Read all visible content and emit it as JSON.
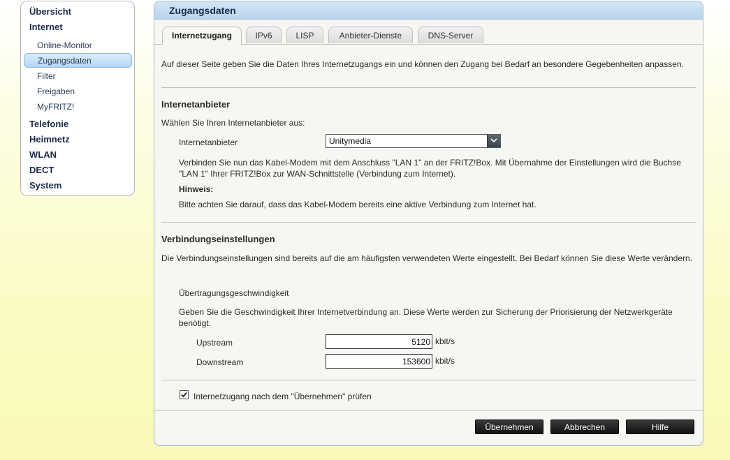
{
  "sidebar": {
    "overview": "Übersicht",
    "internet": "Internet",
    "internet_items": [
      "Online-Monitor",
      "Zugangsdaten",
      "Filter",
      "Freigaben",
      "MyFRITZ!"
    ],
    "telephony": "Telefonie",
    "home_network": "Heimnetz",
    "wlan": "WLAN",
    "dect": "DECT",
    "system": "System"
  },
  "panel": {
    "title": "Zugangsdaten",
    "tabs": [
      "Internetzugang",
      "IPv6",
      "LISP",
      "Anbieter-Dienste",
      "DNS-Server"
    ],
    "intro": "Auf dieser Seite geben Sie die Daten Ihres Internetzugangs ein und können den Zugang bei Bedarf an besondere Gegebenheiten anpassen."
  },
  "provider": {
    "heading": "Internetanbieter",
    "prompt": "Wählen Sie Ihren Internetanbieter aus:",
    "label": "Internetanbieter",
    "selected": "Unitymedia",
    "info": "Verbinden Sie nun das Kabel-Modem mit dem Anschluss \"LAN 1\" an der FRITZ!Box. Mit Übernahme der Einstellungen wird die Buchse \"LAN 1\" Ihrer FRITZ!Box zur WAN-Schnittstelle (Verbindung zum Internet).",
    "note_label": "Hinweis:",
    "note": "Bitte achten Sie darauf, dass das Kabel-Modem bereits eine aktive Verbindung zum Internet hat."
  },
  "connection": {
    "heading": "Verbindungseinstellungen",
    "desc": "Die Verbindungseinstellungen sind bereits auf die am häufigsten verwendeten Werte eingestellt. Bei Bedarf können Sie diese Werte verändern.",
    "speed_heading": "Übertragungsgeschwindigkeit",
    "speed_desc": "Geben Sie die Geschwindigkeit Ihrer Internetverbindung an. Diese Werte werden zur Sicherung der Priorisierung der Netzwerkgeräte benötigt.",
    "upstream_label": "Upstream",
    "upstream_value": "5120",
    "downstream_label": "Downstream",
    "downstream_value": "153600",
    "unit": "kbit/s"
  },
  "check": {
    "label": "Internetzugang nach dem \"Übernehmen\" prüfen",
    "checked": true
  },
  "buttons": {
    "apply": "Übernehmen",
    "cancel": "Abbrechen",
    "help": "Hilfe"
  }
}
